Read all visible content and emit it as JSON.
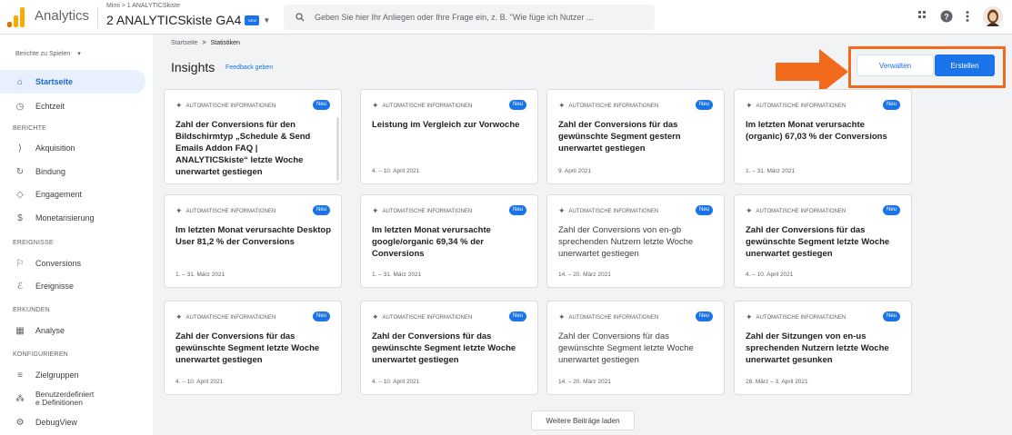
{
  "app": {
    "name": "Analytics",
    "account_path": "Mimi > 1 ANALYTICSkiste",
    "property": "2 ANALYTICSkiste GA4",
    "property_badge": "NEW"
  },
  "search": {
    "placeholder": "Geben Sie hier Ihr Anliegen oder Ihre Frage ein, z. B. \"Wie füge ich Nutzer ..."
  },
  "topbar_icons": [
    "apps-icon",
    "help-icon",
    "more-vert-icon",
    "avatar"
  ],
  "colors": {
    "accent": "#1a73e8",
    "highlight": "#f26b1d",
    "active_bg": "#e8f0fe"
  },
  "sidebar": {
    "dropdown_label": "Berichte zu Spielen",
    "items_main": [
      {
        "label": "Startseite",
        "icon": "home-icon",
        "active": true
      },
      {
        "label": "Echtzeit",
        "icon": "clock-icon"
      }
    ],
    "sections": [
      {
        "title": "BERICHTE",
        "items": [
          {
            "label": "Akquisition",
            "icon": "acquisition-icon"
          },
          {
            "label": "Bindung",
            "icon": "retention-icon"
          },
          {
            "label": "Engagement",
            "icon": "engagement-icon"
          },
          {
            "label": "Monetarisierung",
            "icon": "monetization-icon"
          }
        ]
      },
      {
        "title": "EREIGNISSE",
        "items": [
          {
            "label": "Conversions",
            "icon": "flag-icon"
          },
          {
            "label": "Ereignisse",
            "icon": "events-icon"
          }
        ]
      },
      {
        "title": "ERKUNDEN",
        "items": [
          {
            "label": "Analyse",
            "icon": "analysis-icon"
          }
        ]
      },
      {
        "title": "KONFIGURIEREN",
        "items": [
          {
            "label": "Zielgruppen",
            "icon": "audiences-icon"
          },
          {
            "label": "Benutzerdefiniert\ne Definitionen",
            "icon": "custom-definitions-icon"
          },
          {
            "label": "DebugView",
            "icon": "debug-icon"
          }
        ]
      }
    ]
  },
  "breadcrumb": {
    "home": "Startseite",
    "separator": ">",
    "current": "Statistiken"
  },
  "page": {
    "title": "Insights",
    "feedback": "Feedback geben"
  },
  "buttons": {
    "manage": "Verwalten",
    "create": "Erstellen",
    "load_more": "Weitere Beiträge laden"
  },
  "card_header": "AUTOMATISCHE INFORMATIONEN",
  "card_badge": "Neu",
  "cards": [
    {
      "title": "Zahl der Conversions für den Bildschirmtyp „Schedule & Send Emails Addon FAQ | ANALYTICSkiste“ letzte Woche unerwartet gestiegen",
      "date": "",
      "bold": true
    },
    {
      "title": "Leistung im Vergleich zur Vorwoche",
      "date": "4. – 10. April 2021",
      "bold": true
    },
    {
      "title": "Zahl der Conversions für das gewünschte Segment gestern unerwartet gestiegen",
      "date": "9. April 2021",
      "bold": true
    },
    {
      "title": "Im letzten Monat verursachte (organic) 67,03 % der Conversions",
      "date": "1. – 31. März 2021",
      "bold": true
    },
    {
      "title": "Im letzten Monat verursachte Desktop User 81,2 % der Conversions",
      "date": "1. – 31. März 2021",
      "bold": true
    },
    {
      "title": "Im letzten Monat verursachte google/organic 69,34 % der Conversions",
      "date": "1. – 31. März 2021",
      "bold": true
    },
    {
      "title": "Zahl der Conversions von en-gb sprechenden Nutzern letzte Woche unerwartet gestiegen",
      "date": "14. – 20. März 2021",
      "bold": false
    },
    {
      "title": "Zahl der Conversions für das gewünschte Segment letzte Woche unerwartet gestiegen",
      "date": "4. – 10. April 2021",
      "bold": true
    },
    {
      "title": "Zahl der Conversions für das gewünschte Segment letzte Woche unerwartet gestiegen",
      "date": "4. – 10. April 2021",
      "bold": true
    },
    {
      "title": "Zahl der Conversions für das gewünschte Segment letzte Woche unerwartet gestiegen",
      "date": "4. – 10. April 2021",
      "bold": true
    },
    {
      "title": "Zahl der Conversions für das gewünschte Segment letzte Woche unerwartet gestiegen",
      "date": "14. – 20. März 2021",
      "bold": false
    },
    {
      "title": "Zahl der Sitzungen von en-us sprechenden Nutzern letzte Woche unerwartet gesunken",
      "date": "28. März – 3. April 2021",
      "bold": true
    }
  ]
}
